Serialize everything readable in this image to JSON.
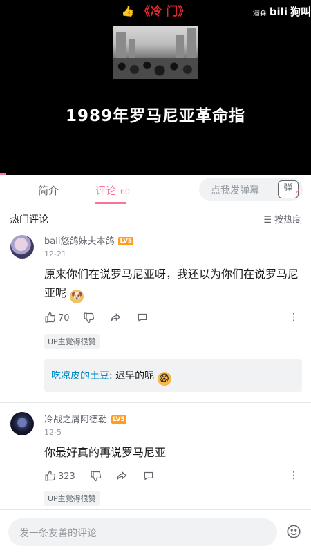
{
  "video": {
    "title": "《冷 门》",
    "watermark_name": "潜森",
    "watermark_logo": "bili",
    "watermark_tail": "狗叫",
    "subtitle": "1989年罗马尼亚革命指",
    "thumb_icon": "thumbs-up-icon",
    "progress_percent": 2
  },
  "tabs": [
    {
      "label": "简介"
    },
    {
      "label": "评论",
      "count": "60"
    }
  ],
  "danmaku": {
    "placeholder": "点我发弹幕",
    "button_label": "弹"
  },
  "hot": {
    "title": "热门评论",
    "sort_label": "按热度"
  },
  "comments": [
    {
      "user": "bali悠鸽妹夫本鸽",
      "level": "LV5",
      "date": "12-21",
      "text": "原来你们在说罗马尼亚呀，我还以为你们在说罗马尼亚呢",
      "likes": "70",
      "badge": "UP主觉得很赞",
      "reply": {
        "user": "吃凉皮的土豆",
        "text": ": 迟早的呢"
      }
    },
    {
      "user": "冷战之屑阿德勒",
      "level": "LV5",
      "date": "12-5",
      "text": "你最好真的再说罗马尼亚",
      "likes": "323",
      "badge": "UP主觉得很赞"
    }
  ],
  "composer": {
    "placeholder": "发一条友善的评论"
  },
  "colors": {
    "accent": "#fb7299",
    "link": "#008ac5",
    "level": "#ff9d23"
  }
}
